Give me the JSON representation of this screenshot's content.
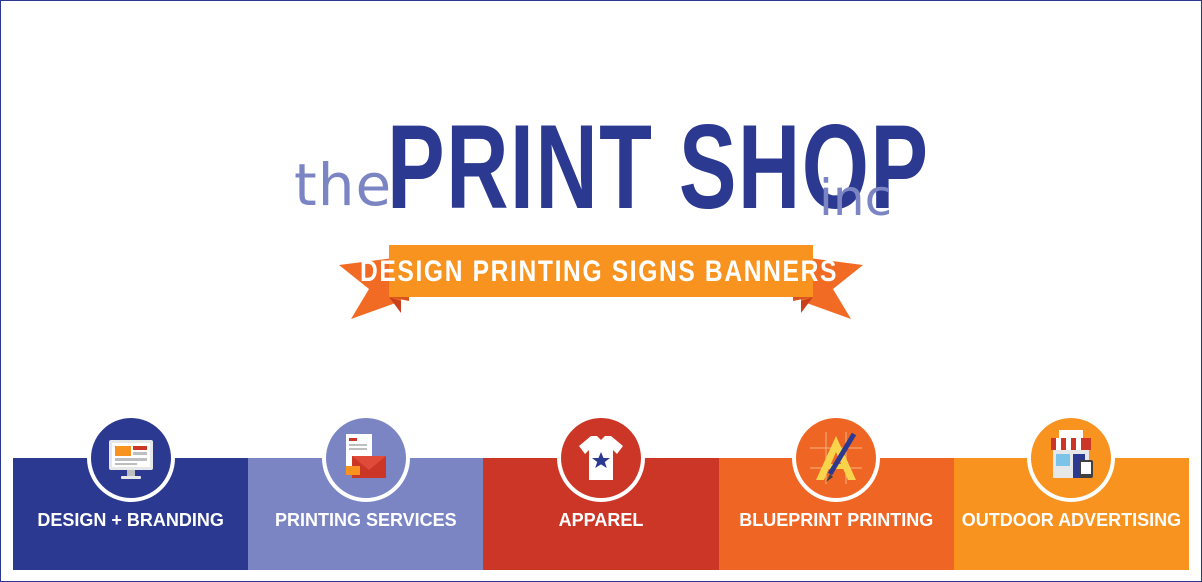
{
  "logo": {
    "prefix": "the",
    "name": "PRINT SHOP",
    "suffix": "inc",
    "tagline": "DESIGN PRINTING SIGNS BANNERS"
  },
  "colors": {
    "navy": "#2b3990",
    "lavender": "#7b85c4",
    "red": "#cc3627",
    "orange_dark": "#ef6523",
    "orange": "#f7931e"
  },
  "services": [
    {
      "label": "DESIGN + BRANDING",
      "icon": "monitor-icon",
      "color": "#2b3990"
    },
    {
      "label": "PRINTING SERVICES",
      "icon": "envelope-icon",
      "color": "#7b85c4"
    },
    {
      "label": "APPAREL",
      "icon": "tshirt-icon",
      "color": "#cc3627"
    },
    {
      "label": "BLUEPRINT PRINTING",
      "icon": "drafting-icon",
      "color": "#ef6523"
    },
    {
      "label": "OUTDOOR ADVERTISING",
      "icon": "storefront-icon",
      "color": "#f7931e"
    }
  ]
}
